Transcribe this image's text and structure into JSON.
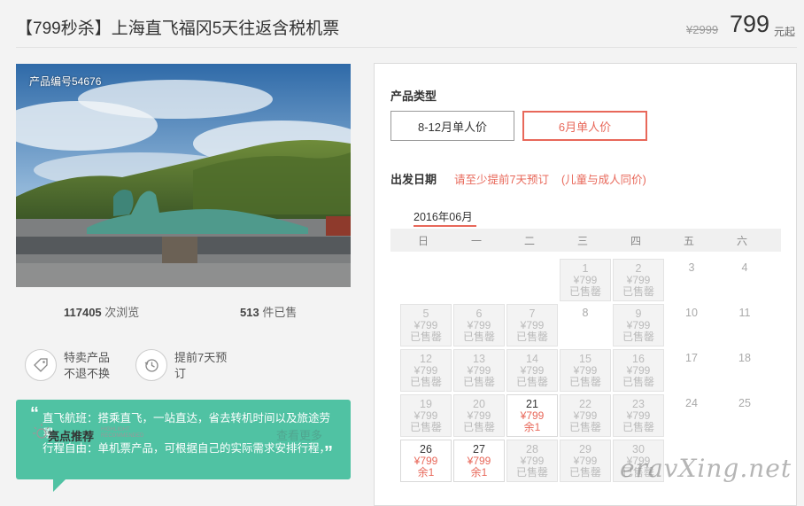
{
  "header": {
    "title": "【799秒杀】上海直飞福冈5天往返含税机票",
    "price_old": "¥2999",
    "price_new": "799",
    "price_unit": "元起"
  },
  "product": {
    "number_label": "产品编号54676",
    "views_count": "117405",
    "views_label": " 次浏览",
    "sold_count": "513",
    "sold_label": " 件已售",
    "features": [
      {
        "icon": "tag-icon",
        "line1": "特卖产品",
        "line2": "不退不换"
      },
      {
        "icon": "clock-icon",
        "line1": "提前7天预",
        "line2": "订"
      }
    ],
    "quote": {
      "line1": "直飞航班：搭乘直飞，一站直达，省去转机时间以及旅途劳",
      "line2": "累",
      "line3": "行程自由：单机票产品，可根据自己的实际需求安排行程，"
    },
    "highlight": {
      "title": "亮点推荐",
      "sub1": "HIGHLIGHT",
      "sub2": "RECOMMENDED",
      "more": "查看更多"
    }
  },
  "booking": {
    "type_label": "产品类型",
    "types": [
      {
        "label": "8-12月单人价",
        "active": false
      },
      {
        "label": "6月单人价",
        "active": true
      }
    ],
    "date_label": "出发日期",
    "note1": "请至少提前7天预订",
    "note2": "(儿童与成人同价)",
    "month": "2016年06月",
    "weekdays": [
      "日",
      "一",
      "二",
      "三",
      "四",
      "五",
      "六"
    ],
    "price": "¥799",
    "sold_out": "已售罄",
    "remaining": "余1",
    "days": [
      {
        "d": "1",
        "state": "sold"
      },
      {
        "d": "2",
        "state": "sold"
      },
      {
        "d": "3",
        "state": "plain"
      },
      {
        "d": "4",
        "state": "plain"
      },
      {
        "d": "5",
        "state": "sold"
      },
      {
        "d": "6",
        "state": "sold"
      },
      {
        "d": "7",
        "state": "sold"
      },
      {
        "d": "8",
        "state": "plain"
      },
      {
        "d": "9",
        "state": "sold"
      },
      {
        "d": "10",
        "state": "plain"
      },
      {
        "d": "11",
        "state": "plain"
      },
      {
        "d": "12",
        "state": "sold"
      },
      {
        "d": "13",
        "state": "sold"
      },
      {
        "d": "14",
        "state": "sold"
      },
      {
        "d": "15",
        "state": "sold"
      },
      {
        "d": "16",
        "state": "sold"
      },
      {
        "d": "17",
        "state": "plain"
      },
      {
        "d": "18",
        "state": "plain"
      },
      {
        "d": "19",
        "state": "sold"
      },
      {
        "d": "20",
        "state": "sold"
      },
      {
        "d": "21",
        "state": "avail"
      },
      {
        "d": "22",
        "state": "sold"
      },
      {
        "d": "23",
        "state": "sold"
      },
      {
        "d": "24",
        "state": "plain"
      },
      {
        "d": "25",
        "state": "plain"
      },
      {
        "d": "26",
        "state": "avail"
      },
      {
        "d": "27",
        "state": "avail"
      },
      {
        "d": "28",
        "state": "sold"
      },
      {
        "d": "29",
        "state": "sold"
      },
      {
        "d": "30",
        "state": "sold"
      }
    ]
  },
  "watermark": "eravXing.net"
}
